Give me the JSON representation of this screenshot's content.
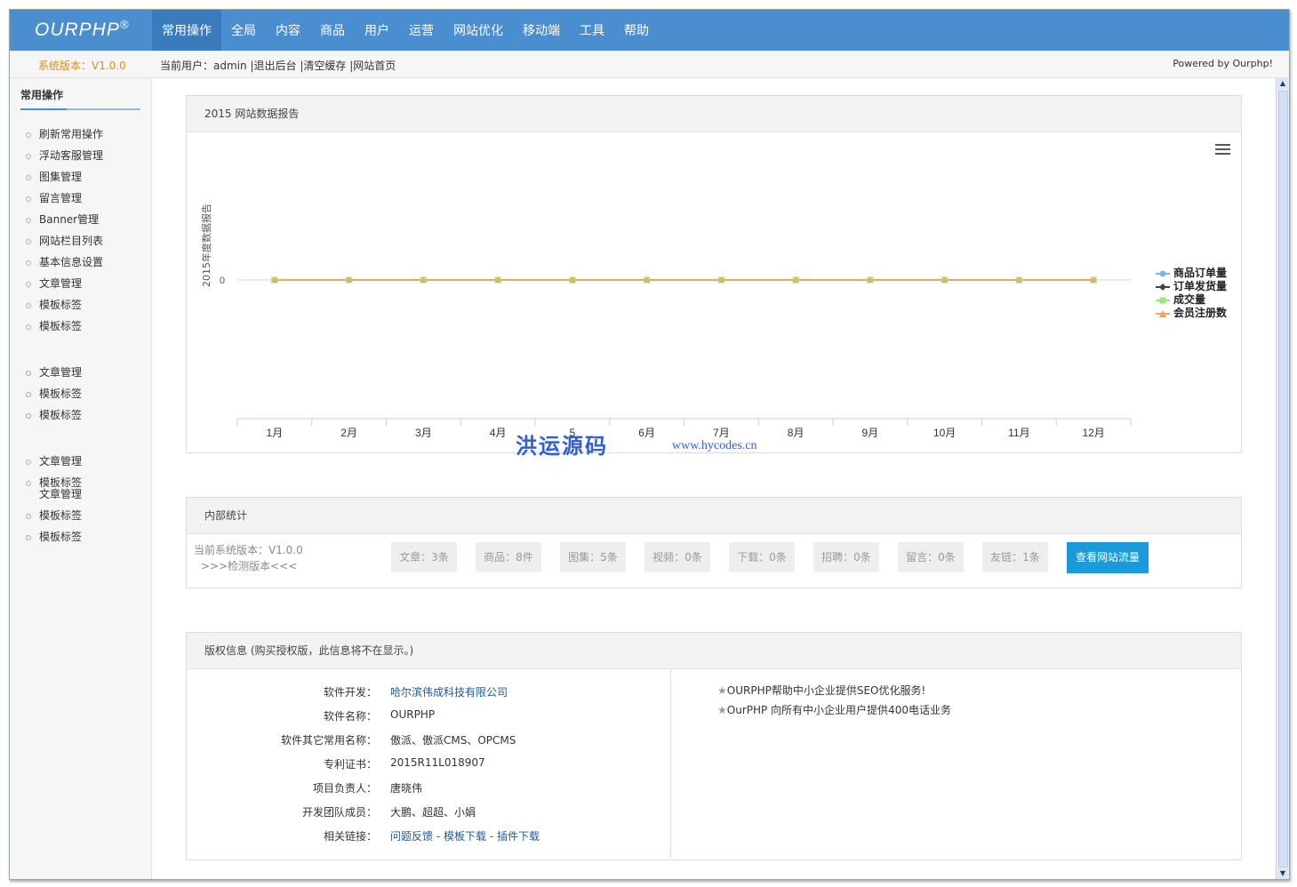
{
  "header": {
    "logo": "OURPHP",
    "logo_mark": "®",
    "nav": [
      {
        "label": "常用操作",
        "active": true
      },
      {
        "label": "全局"
      },
      {
        "label": "内容"
      },
      {
        "label": "商品"
      },
      {
        "label": "用户"
      },
      {
        "label": "运营"
      },
      {
        "label": "网站优化"
      },
      {
        "label": "移动端"
      },
      {
        "label": "工具"
      },
      {
        "label": "帮助"
      }
    ]
  },
  "subbar": {
    "version": "系统版本：V1.0.0",
    "current_user_prefix": "当前用户：",
    "current_user": "admin",
    "sep": "|",
    "logout": "退出后台",
    "clear_cache": "清空缓存",
    "home": "网站首页",
    "powered": "Powered by Ourphp!"
  },
  "sidebar": {
    "title": "常用操作",
    "groups": [
      [
        "刷新常用操作",
        "浮动客服管理",
        "图集管理",
        "留言管理",
        "Banner管理",
        "网站栏目列表",
        "基本信息设置",
        "文章管理",
        "模板标签",
        "模板标签"
      ],
      [
        "文章管理",
        "模板标签",
        "模板标签"
      ],
      [
        "文章管理",
        "模板标签"
      ],
      [
        "文章管理",
        "模板标签",
        "模板标签"
      ]
    ]
  },
  "report": {
    "title": "2015 网站数据报告",
    "watermark_cn": "洪运源码",
    "watermark_url": "www.hycodes.cn"
  },
  "chart_data": {
    "type": "line",
    "ylabel": "2015年度数据报告",
    "categories": [
      "1月",
      "2月",
      "3月",
      "4月",
      "5",
      "6月",
      "7月",
      "8月",
      "9月",
      "10月",
      "11月",
      "12月"
    ],
    "y_ticks": [
      "0"
    ],
    "series": [
      {
        "name": "商品订单量",
        "color": "#7cb5ec",
        "values": [
          0,
          0,
          0,
          0,
          0,
          0,
          0,
          0,
          0,
          0,
          0,
          0
        ]
      },
      {
        "name": "订单发货量",
        "color": "#434348",
        "values": [
          0,
          0,
          0,
          0,
          0,
          0,
          0,
          0,
          0,
          0,
          0,
          0
        ]
      },
      {
        "name": "成交量",
        "color": "#90ed7d",
        "values": [
          0,
          0,
          0,
          0,
          0,
          0,
          0,
          0,
          0,
          0,
          0,
          0
        ]
      },
      {
        "name": "会员注册数",
        "color": "#f7a35c",
        "values": [
          0,
          0,
          0,
          0,
          0,
          0,
          0,
          0,
          0,
          0,
          0,
          0
        ]
      }
    ]
  },
  "stats": {
    "title": "内部统计",
    "version": "当前系统版本：V1.0.0",
    "check": ">>>检测版本<<<",
    "items": [
      "文章：3条",
      "商品：8件",
      "图集：5条",
      "视频：0条",
      "下载：0条",
      "招聘：0条",
      "留言：0条",
      "友链：1条"
    ],
    "button": "查看网站流量"
  },
  "copyright": {
    "title": "版权信息 (购买授权版，此信息将不在显示。)",
    "rows": [
      {
        "k": "软件开发：",
        "v": "哈尔滨伟成科技有限公司"
      },
      {
        "k": "软件名称：",
        "v": "OURPHP"
      },
      {
        "k": "软件其它常用名称：",
        "v": "傲派、傲派CMS、OPCMS"
      },
      {
        "k": "专利证书：",
        "v": "2015R11L018907"
      },
      {
        "k": "项目负责人：",
        "v": "唐晓伟"
      },
      {
        "k": "开发团队成员：",
        "v": "大鹏、超超、小娟"
      }
    ],
    "links_label": "相关链接：",
    "links": [
      "问题反馈",
      "模板下载",
      "插件下载"
    ],
    "link_sep": " - ",
    "news_star": "★",
    "news": [
      "OURPHP帮助中小企业提供SEO优化服务!",
      "OurPHP 向所有中小企业用户提供400电话业务"
    ]
  }
}
